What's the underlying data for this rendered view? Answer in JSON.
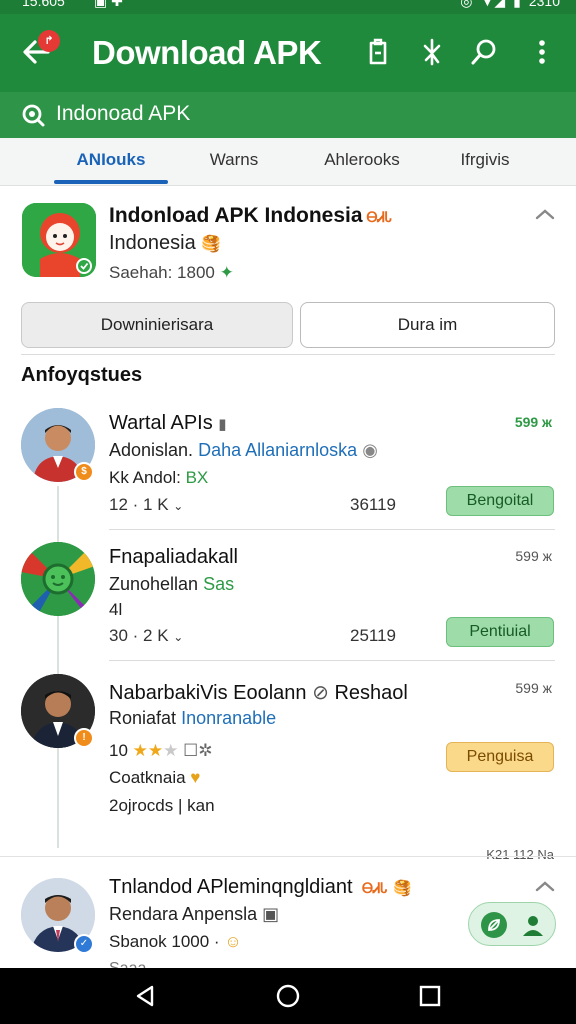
{
  "status_bar": {
    "time": "15:605",
    "battery": "2310"
  },
  "app_bar": {
    "title": "Download APK",
    "notification_badge": "↱",
    "actions": [
      "clipboard-icon",
      "pin-icon",
      "search-icon",
      "more-vert-icon"
    ]
  },
  "search": {
    "placeholder": "Indonoad APK"
  },
  "tabs": [
    {
      "label": "ANIouks",
      "active": true
    },
    {
      "label": "Warns",
      "active": false
    },
    {
      "label": "Ahlerooks",
      "active": false
    },
    {
      "label": "Ifrgivis",
      "active": false
    }
  ],
  "app": {
    "name": "Indonload APK Indonesia",
    "name_badge": "ᎾᏗᏓ",
    "subtitle": "Indonesia",
    "meta": "Saehah: 1800",
    "primary_button": "Downinierisara",
    "secondary_button": "Dura im"
  },
  "section": {
    "title": "Anfoyqstues"
  },
  "items": [
    {
      "title": "Wartal APIs",
      "line1_a": "Adonislan.",
      "line1_b": "Daha Allaniarnloska",
      "line2_a": "Kk Andol:",
      "line2_b": "BX",
      "stats": "12 · 1 K",
      "count": "36119",
      "size": "599 ж",
      "action": "Bengoital"
    },
    {
      "title": "Fnapaliadakall",
      "line1_a": "Zunohellan",
      "line1_b": "Sas",
      "line2_a": "4l",
      "line2_b": "",
      "stats": "30 · 2 K",
      "count": "25119",
      "size": "599 ж",
      "action": "Pentiuial"
    },
    {
      "title": "NabarbakiVis Eoolann",
      "title_b": "Reshaol",
      "line1_a": "Roniafat",
      "line1_b": "Inonranable",
      "rating": "10",
      "line2_a": "Coatknaia",
      "line2_b": "",
      "line3": "2ojrocds | kan",
      "size": "599 ж",
      "action": "Penguisa"
    }
  ],
  "footer_note": "K21 112 Na",
  "bottom_card": {
    "title": "Tnlandod APleminqngldiant",
    "title_badge": "ᎾᏗᏓ",
    "subtitle": "Rendara Anpensla",
    "meta": "Sbanok 1000 ·",
    "meta2": "Saaa..."
  },
  "colors": {
    "primary": "#208a3c",
    "accent": "#1a63b8",
    "pill_green": "#9edca9",
    "pill_amber": "#fbd98b"
  }
}
